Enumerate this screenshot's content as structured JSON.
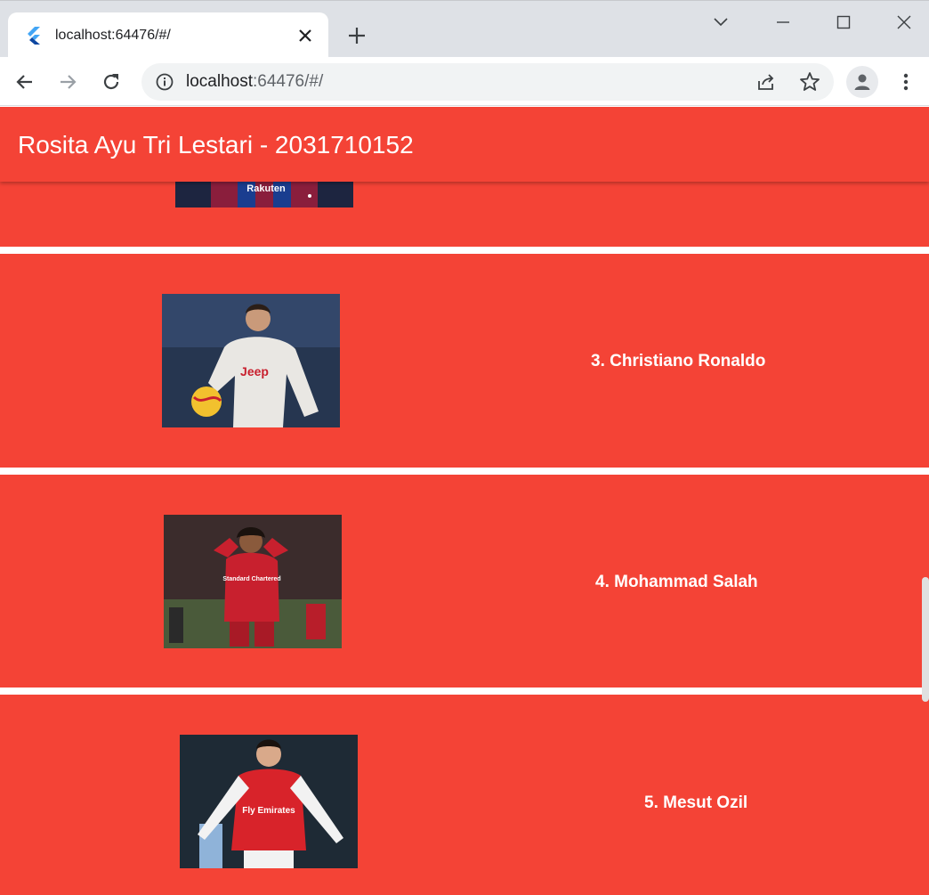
{
  "browser": {
    "tab_title": "localhost:64476/#/",
    "url_host": "localhost",
    "url_rest": ":64476/#/"
  },
  "app": {
    "title": "Rosita Ayu Tri Lestari - 2031710152",
    "accent_color": "#f44336"
  },
  "players": [
    {
      "label": "3. Christiano Ronaldo",
      "kit": "Jeep",
      "kit_color": "#e9e7e3",
      "bg": "#2a3a52"
    },
    {
      "label": "4. Mohammad Salah",
      "kit": "Standard Chartered",
      "kit_color": "#c8202e",
      "bg": "#3a2a2a"
    },
    {
      "label": "5. Mesut Ozil",
      "kit": "Fly Emirates",
      "kit_color": "#d8232a",
      "bg": "#1e2a35"
    }
  ],
  "top_partial": {
    "kit_text": "Rakuten"
  }
}
